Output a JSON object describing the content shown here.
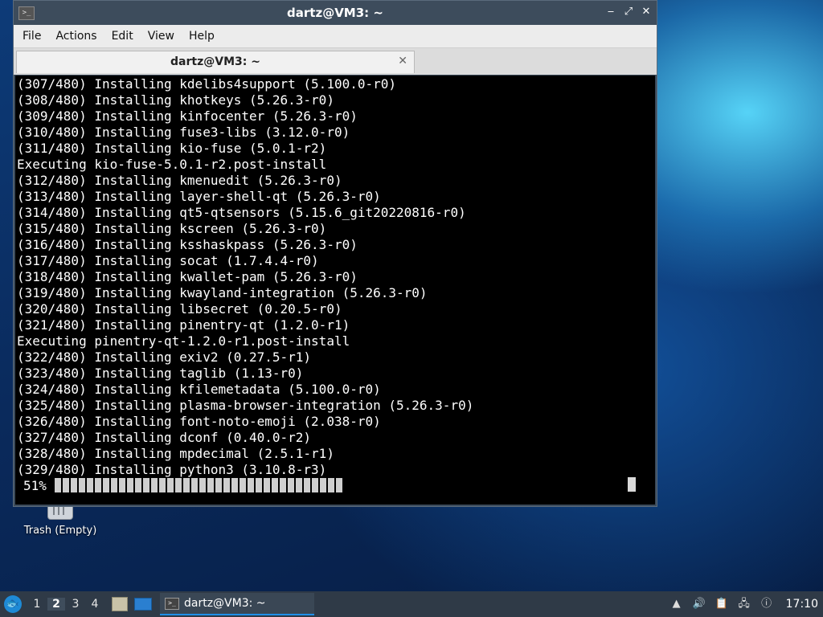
{
  "desktop": {
    "trash_label": "Trash (Empty)"
  },
  "window": {
    "title": "dartz@VM3: ~",
    "app_icon_glyph": ">_",
    "controls": {
      "minimize": "‒",
      "maximize": "⤢",
      "close": "✕"
    }
  },
  "menubar": {
    "items": [
      "File",
      "Actions",
      "Edit",
      "View",
      "Help"
    ]
  },
  "tab": {
    "label": "dartz@VM3: ~",
    "close_glyph": "✕"
  },
  "terminal": {
    "lines": [
      "(307/480) Installing kdelibs4support (5.100.0-r0)",
      "(308/480) Installing khotkeys (5.26.3-r0)",
      "(309/480) Installing kinfocenter (5.26.3-r0)",
      "(310/480) Installing fuse3-libs (3.12.0-r0)",
      "(311/480) Installing kio-fuse (5.0.1-r2)",
      "Executing kio-fuse-5.0.1-r2.post-install",
      "(312/480) Installing kmenuedit (5.26.3-r0)",
      "(313/480) Installing layer-shell-qt (5.26.3-r0)",
      "(314/480) Installing qt5-qtsensors (5.15.6_git20220816-r0)",
      "(315/480) Installing kscreen (5.26.3-r0)",
      "(316/480) Installing ksshaskpass (5.26.3-r0)",
      "(317/480) Installing socat (1.7.4.4-r0)",
      "(318/480) Installing kwallet-pam (5.26.3-r0)",
      "(319/480) Installing kwayland-integration (5.26.3-r0)",
      "(320/480) Installing libsecret (0.20.5-r0)",
      "(321/480) Installing pinentry-qt (1.2.0-r1)",
      "Executing pinentry-qt-1.2.0-r1.post-install",
      "(322/480) Installing exiv2 (0.27.5-r1)",
      "(323/480) Installing taglib (1.13-r0)",
      "(324/480) Installing kfilemetadata (5.100.0-r0)",
      "(325/480) Installing plasma-browser-integration (5.26.3-r0)",
      "(326/480) Installing font-noto-emoji (2.038-r0)",
      "(327/480) Installing dconf (0.40.0-r2)",
      "(328/480) Installing mpdecimal (2.5.1-r1)",
      "(329/480) Installing python3 (3.10.8-r3)"
    ],
    "progress_text": "51%",
    "progress_fraction": 0.51
  },
  "taskbar": {
    "start_glyph": "🐟",
    "workspaces": [
      "1",
      "2",
      "3",
      "4"
    ],
    "active_workspace": "2",
    "task_label": "dartz@VM3: ~",
    "task_icon_glyph": ">_",
    "tray_icons": [
      "scroll-up-icon",
      "volume-icon",
      "clipboard-icon",
      "network-icon",
      "update-icon"
    ],
    "clock": "17:10"
  }
}
